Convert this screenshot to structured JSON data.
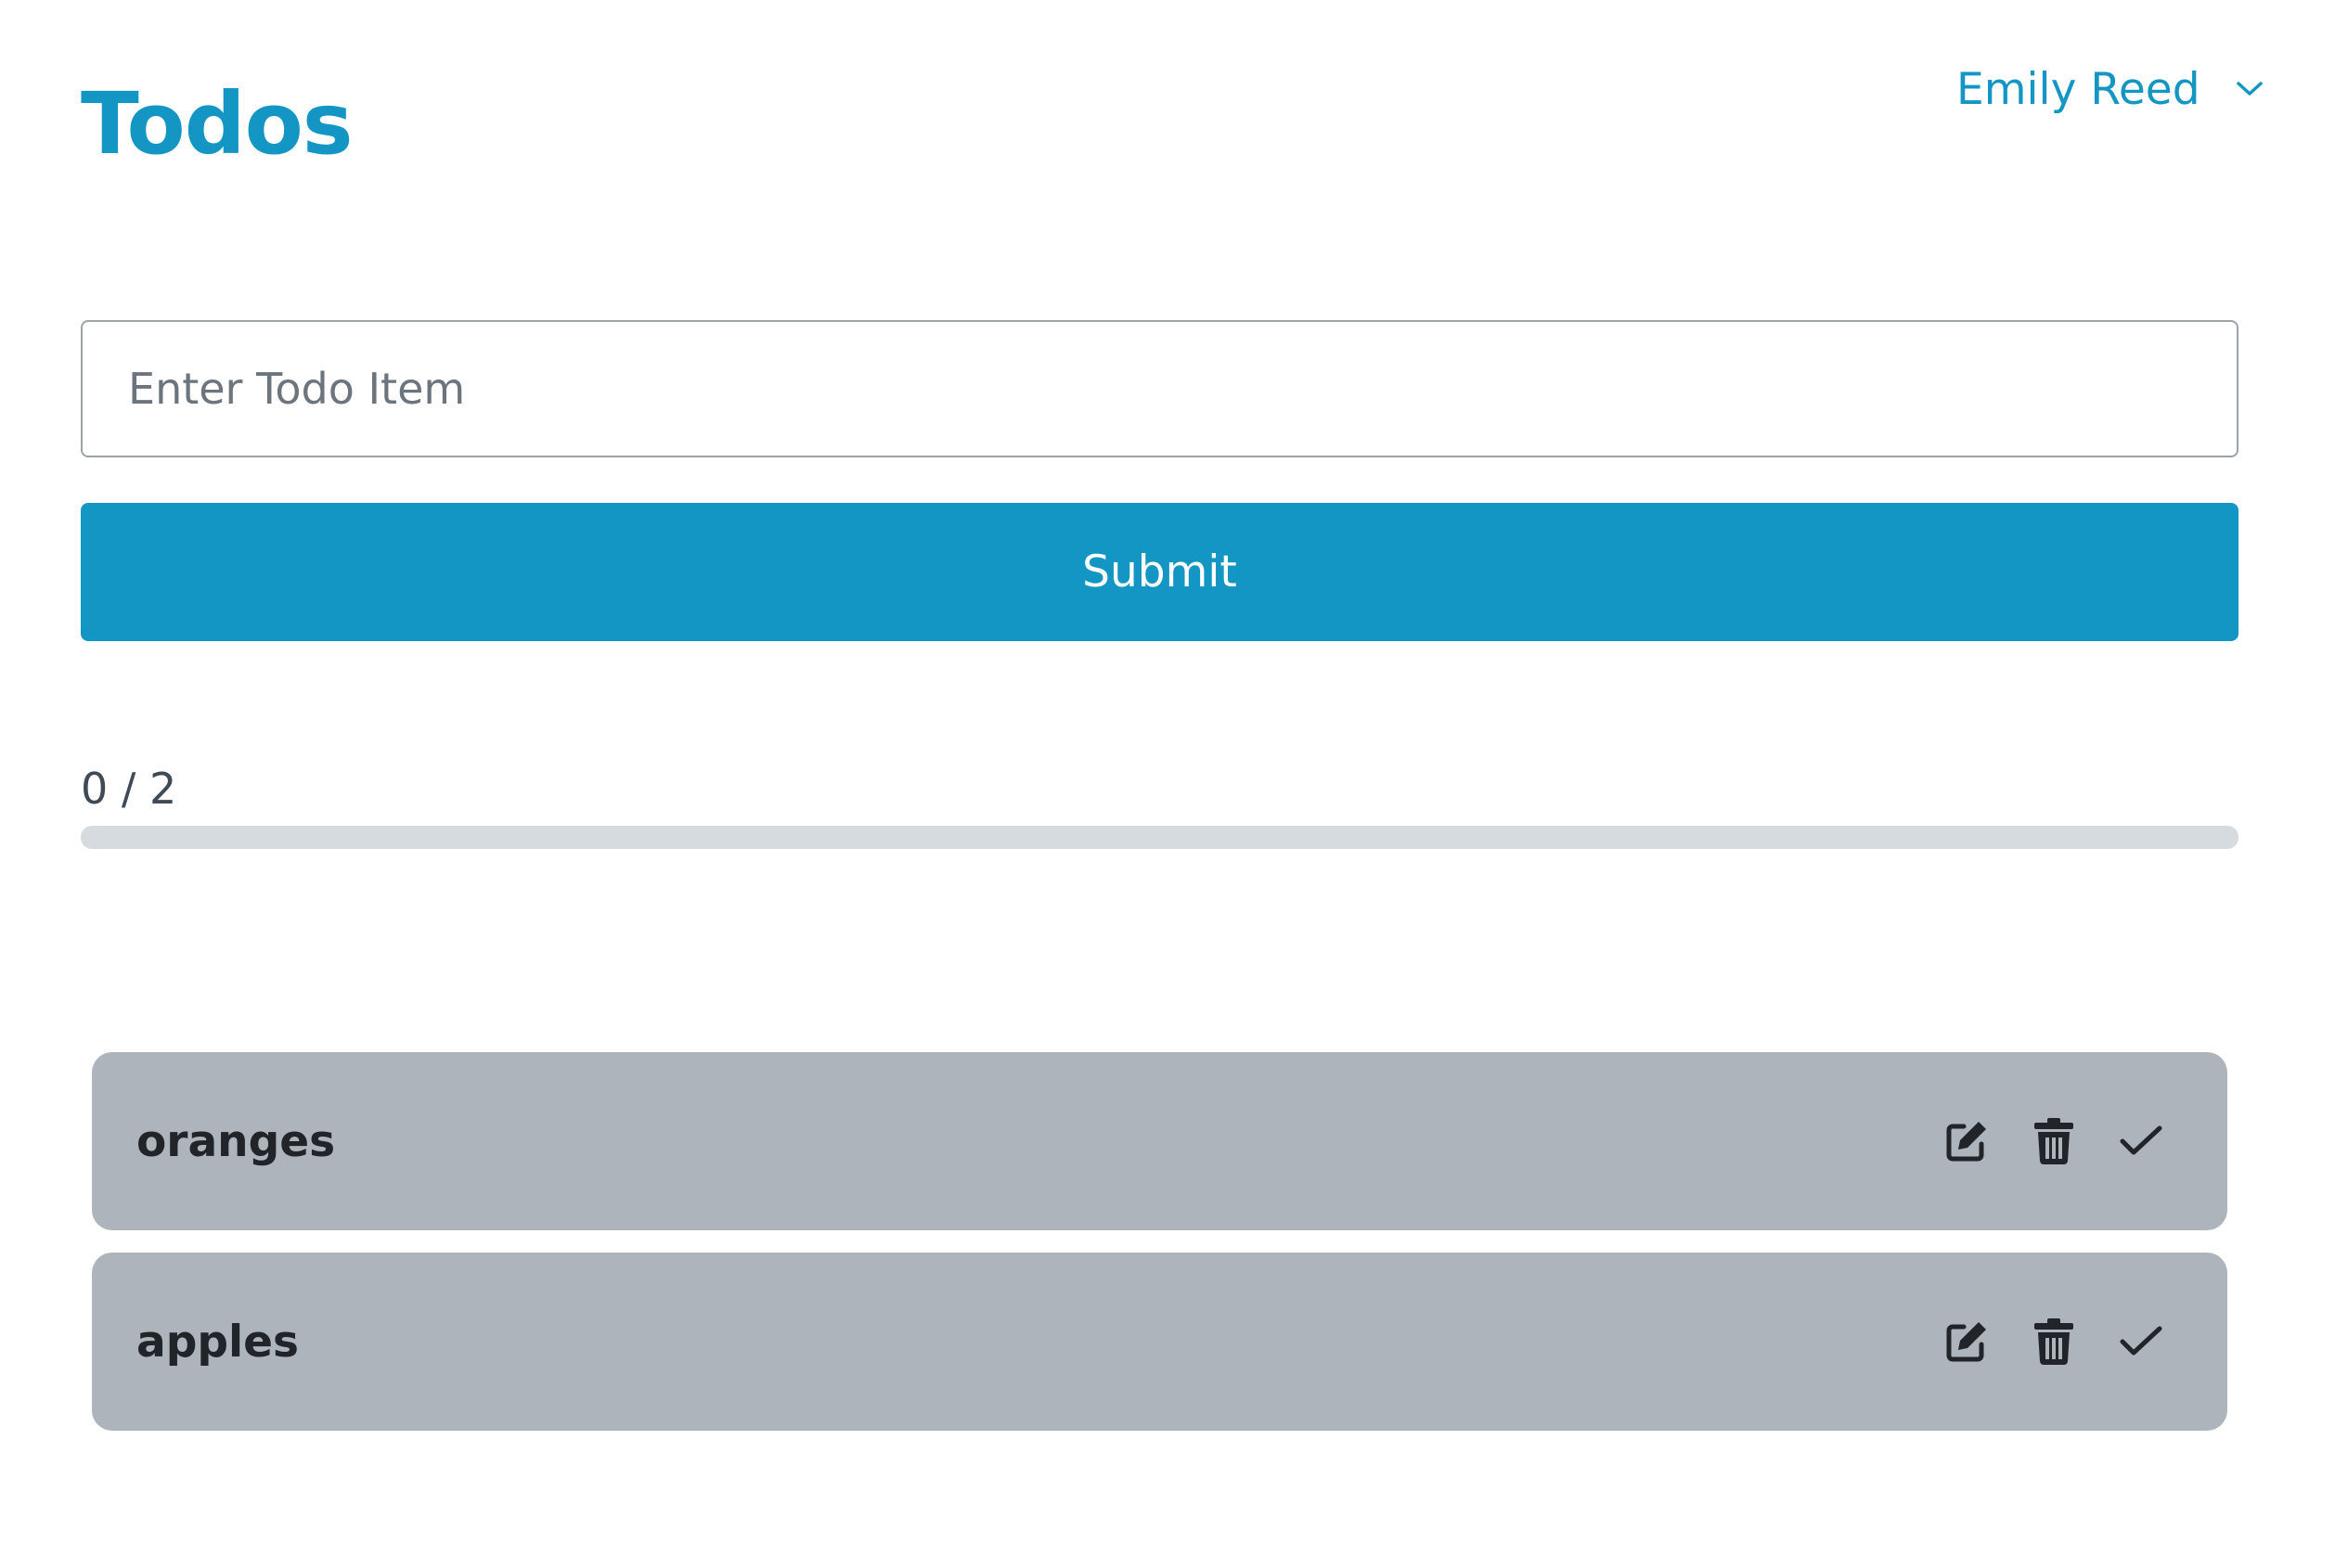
{
  "header": {
    "title": "Todos",
    "user_name": "Emily Reed",
    "user_menu_icon": "chevron-down-icon"
  },
  "form": {
    "input_placeholder": "Enter Todo Item",
    "input_value": "",
    "submit_label": "Submit"
  },
  "progress": {
    "label": "0 / 2",
    "completed": 0,
    "total": 2
  },
  "todos": [
    {
      "text": "oranges",
      "completed": false,
      "actions": [
        "edit-icon",
        "trash-icon",
        "check-icon"
      ]
    },
    {
      "text": "apples",
      "completed": false,
      "actions": [
        "edit-icon",
        "trash-icon",
        "check-icon"
      ]
    }
  ],
  "colors": {
    "accent": "#1396c3",
    "todo_background": "#adb4bb",
    "progress_track": "#d6dbdf",
    "text_dark": "#212529"
  }
}
